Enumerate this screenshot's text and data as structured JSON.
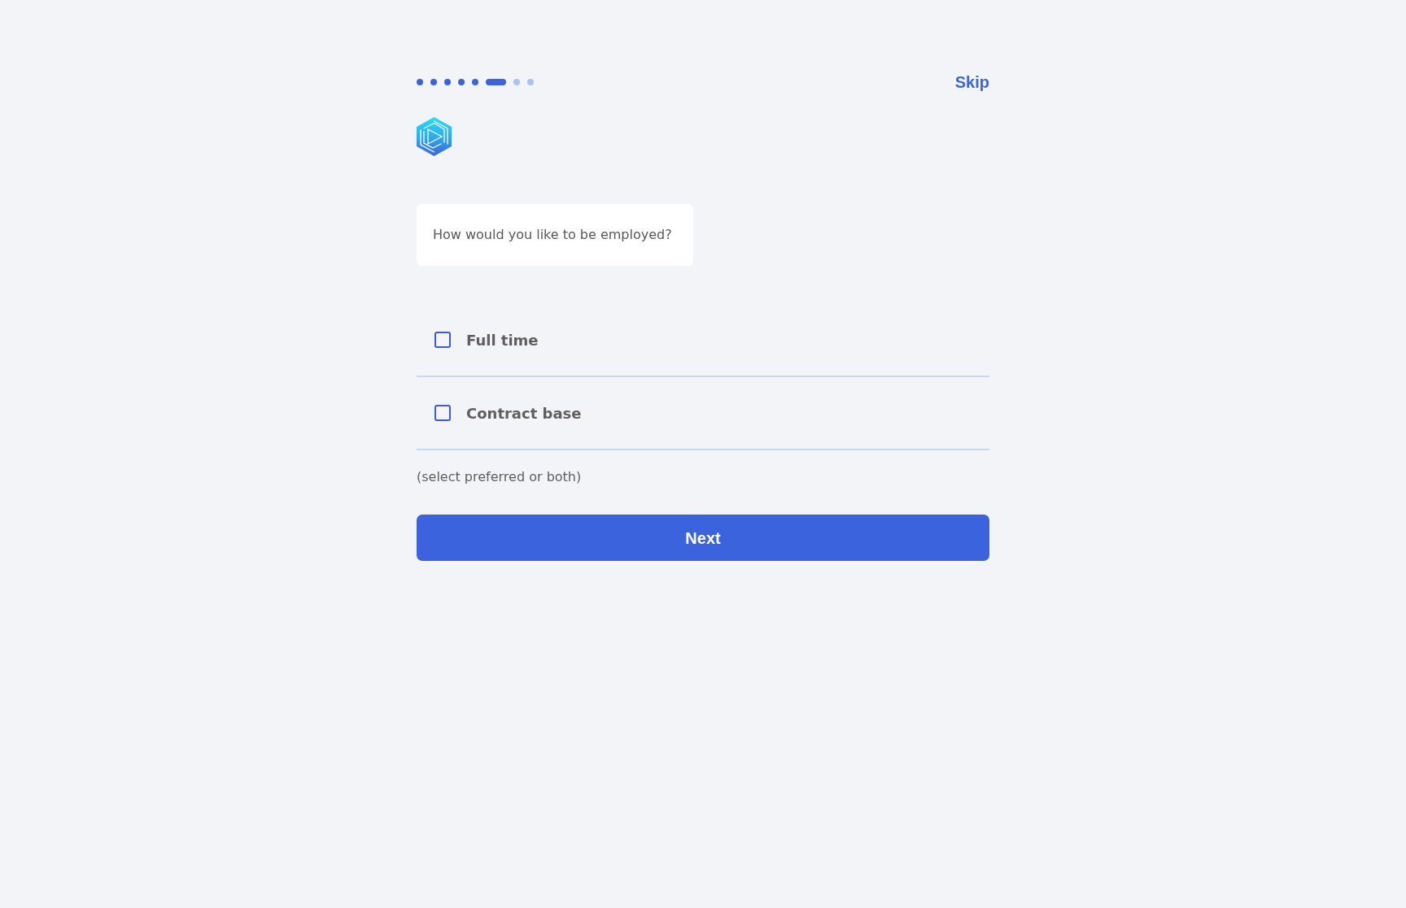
{
  "progress": {
    "steps": [
      {
        "kind": "completed"
      },
      {
        "kind": "completed"
      },
      {
        "kind": "completed"
      },
      {
        "kind": "completed"
      },
      {
        "kind": "completed"
      },
      {
        "kind": "current"
      },
      {
        "kind": "upcoming"
      },
      {
        "kind": "upcoming"
      }
    ]
  },
  "skip": {
    "label": "Skip"
  },
  "question": "How would you like to be employed?",
  "options": [
    {
      "label": "Full time",
      "checked": false
    },
    {
      "label": "Contract base",
      "checked": false
    }
  ],
  "hint": "(select preferred or both)",
  "next_button": {
    "label": "Next"
  }
}
